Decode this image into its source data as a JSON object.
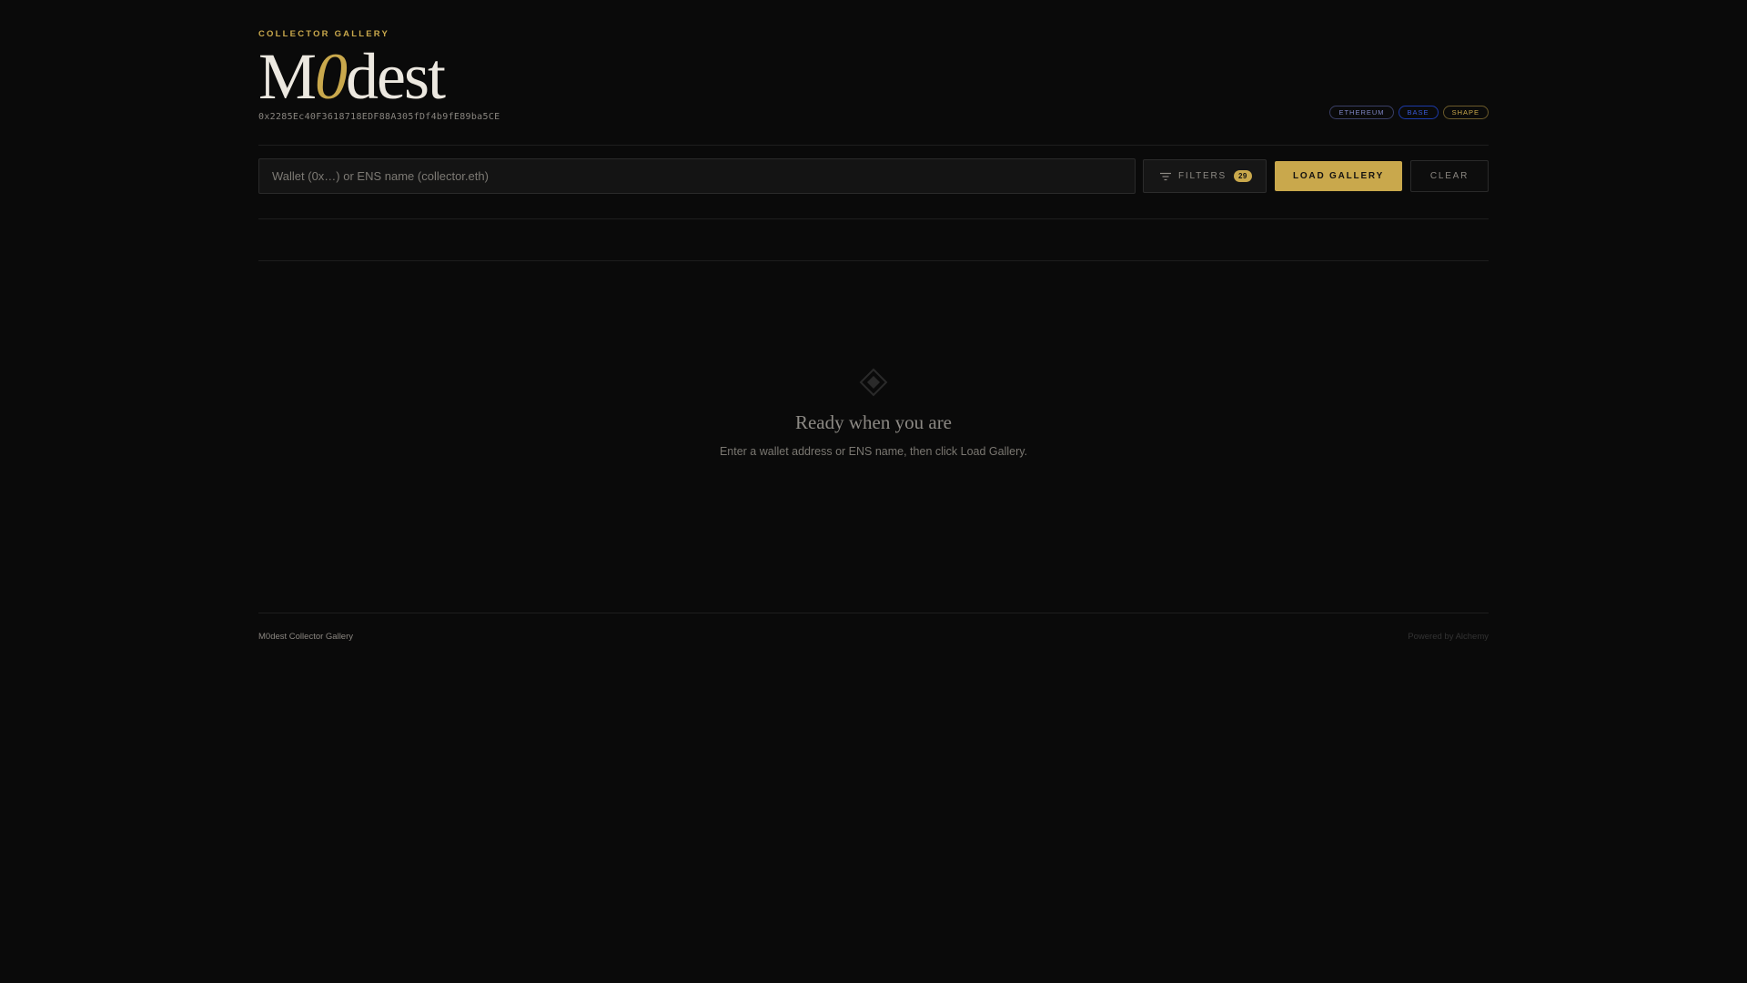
{
  "header": {
    "eyebrow": "COLLECTOR GALLERY",
    "logo_part1": "M",
    "logo_accent": "0",
    "logo_part2": "dest",
    "address": "0x2285Ec40F3618718EDF88A305fDf4b9fE89ba5CE",
    "chains": [
      {
        "label": "ETHEREUM",
        "color": "#7f86c4"
      },
      {
        "label": "BASE",
        "color": "#3a5bd9"
      },
      {
        "label": "SHAPE",
        "color": "#c9a84c"
      }
    ]
  },
  "toolbar": {
    "search_placeholder": "Wallet (0x…) or ENS name (collector.eth)",
    "search_value": "",
    "filters_label": "FILTERS",
    "filters_count": "29",
    "load_label": "LOAD GALLERY",
    "clear_label": "CLEAR",
    "accent_color": "#c9a84c"
  },
  "empty_state": {
    "icon": "diamond-icon",
    "title": "Ready when you are",
    "subtitle": "Enter a wallet address or ENS name, then click Load Gallery."
  },
  "footer": {
    "left": "M0dest Collector Gallery",
    "right": "Powered by Alchemy"
  }
}
